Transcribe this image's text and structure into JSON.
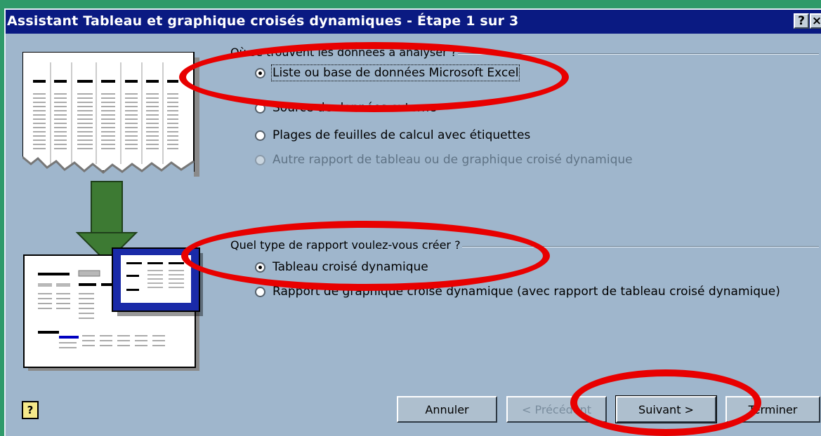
{
  "dialog": {
    "title": "Assistant Tableau et graphique croisés dynamiques - Étape 1 sur 3",
    "help_button": "?",
    "close_button": "×"
  },
  "section1": {
    "label": "Où se trouvent les données à analyser ?",
    "options": [
      {
        "label": "Liste ou base de données Microsoft Excel",
        "selected": true,
        "enabled": true
      },
      {
        "label": "Source de données externe",
        "selected": false,
        "enabled": true
      },
      {
        "label": "Plages de feuilles de calcul avec étiquettes",
        "selected": false,
        "enabled": true
      },
      {
        "label": "Autre rapport de tableau ou de graphique croisé dynamique",
        "selected": false,
        "enabled": false
      }
    ]
  },
  "section2": {
    "label": "Quel type de rapport voulez-vous créer ?",
    "options": [
      {
        "label": "Tableau croisé dynamique",
        "selected": true,
        "enabled": true
      },
      {
        "label": "Rapport de graphique croisé dynamique (avec rapport de tableau croisé dynamique)",
        "selected": false,
        "enabled": true
      }
    ]
  },
  "footer": {
    "help_icon": "?",
    "cancel_label": "Annuler",
    "previous_label": "< Précédent",
    "next_label": "Suivant >",
    "finish_label": "Terminer"
  },
  "colors": {
    "titlebar": "#0a1a82",
    "dialog_bg": "#9fb6cc",
    "annotation": "#e80000",
    "arrow": "#3d7a33",
    "frame": "#2f9a6a"
  },
  "icons": [
    "help-icon",
    "close-icon",
    "wizard-illustration",
    "down-arrow-icon"
  ]
}
